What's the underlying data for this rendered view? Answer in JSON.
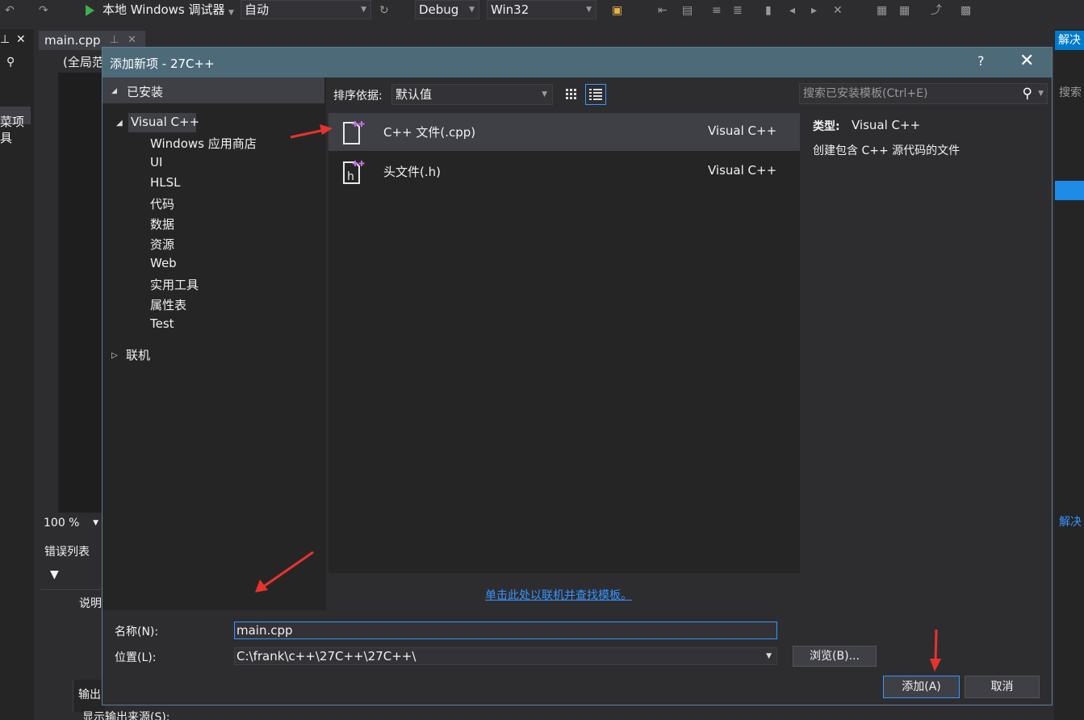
{
  "ide": {
    "debugger_label": "本地 Windows 调试器",
    "config_auto": "自动",
    "config_debug": "Debug",
    "platform": "Win32",
    "editor_tab": "main.cpp",
    "scope": "(全局范",
    "zoom": "100 %",
    "error_list": "错误列表",
    "desc_col": "说明",
    "output": "输出",
    "show_output_from": "显示输出来源(S):",
    "left_text_1": "菜项",
    "left_text_2": "具",
    "right_tab": "解决",
    "right_search": "搜索",
    "right_bottom": "解决"
  },
  "dialog": {
    "title": "添加新项 - 27C++",
    "help": "?",
    "close": "✕",
    "tree": {
      "installed": "已安装",
      "visual_cpp": "Visual C++",
      "children": [
        "Windows 应用商店",
        "UI",
        "HLSL",
        "代码",
        "数据",
        "资源",
        "Web",
        "实用工具",
        "属性表",
        "Test"
      ],
      "online": "联机"
    },
    "sort_label": "排序依据:",
    "sort_value": "默认值",
    "search_placeholder": "搜索已安装模板(Ctrl+E)",
    "templates": [
      {
        "name": "C++ 文件(.cpp)",
        "lang": "Visual C++",
        "icon": "cpp-file-icon"
      },
      {
        "name": "头文件(.h)",
        "lang": "Visual C++",
        "icon": "header-file-icon"
      }
    ],
    "desc": {
      "type_label": "类型:",
      "type_value": "Visual C++",
      "description": "创建包含 C++ 源代码的文件"
    },
    "online_link": "单击此处以联机并查找模板。",
    "name_label": "名称(N):",
    "name_value": "main.cpp",
    "location_label": "位置(L):",
    "location_value": "C:\\frank\\c++\\27C++\\27C++\\",
    "browse": "浏览(B)...",
    "add": "添加(A)",
    "cancel": "取消"
  },
  "colors": {
    "accent": "#3399ff",
    "title_bar": "#4d6a79",
    "annotation_arrow": "#e8332d",
    "icon_plus": "#c46ee0"
  }
}
